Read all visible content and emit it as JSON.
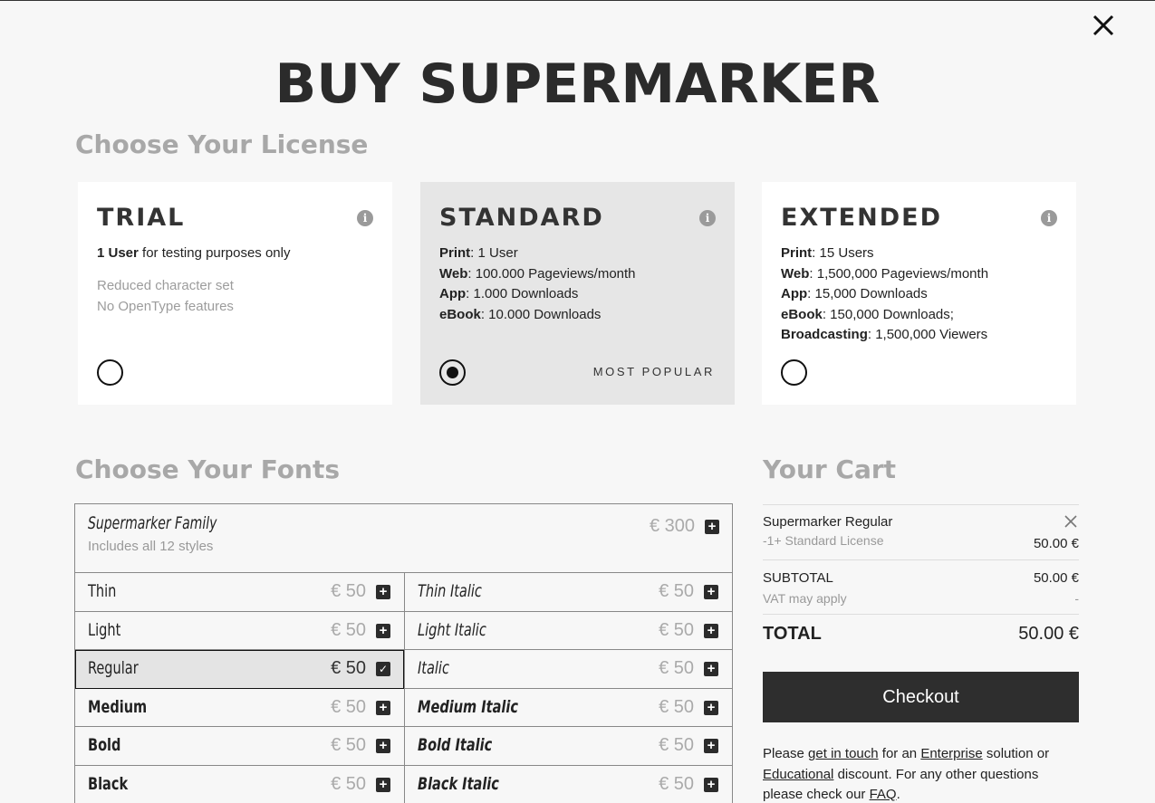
{
  "page": {
    "title": "BUY SUPERMARKER",
    "license_heading": "Choose Your License",
    "fonts_heading": "Choose Your Fonts",
    "cart_heading": "Your Cart"
  },
  "licenses": [
    {
      "name": "TRIAL",
      "selected": false,
      "lines": [
        {
          "bold": "1 User",
          "text": " for testing purposes only"
        }
      ],
      "muted": [
        "Reduced character set",
        "No OpenType features"
      ]
    },
    {
      "name": "STANDARD",
      "selected": true,
      "badge": "MOST POPULAR",
      "lines": [
        {
          "bold": "Print",
          "text": ": 1 User"
        },
        {
          "bold": "Web",
          "text": ": 100.000 Pageviews/month"
        },
        {
          "bold": "App",
          "text": ": 1.000 Downloads"
        },
        {
          "bold": "eBook",
          "text": ": 10.000 Downloads"
        }
      ]
    },
    {
      "name": "EXTENDED",
      "selected": false,
      "lines": [
        {
          "bold": "Print",
          "text": ": 15 Users"
        },
        {
          "bold": "Web",
          "text": ": 1,500,000 Pageviews/month"
        },
        {
          "bold": "App",
          "text": ": 15,000 Downloads"
        },
        {
          "bold": "eBook",
          "text": ": 150,000 Downloads;"
        },
        {
          "bold": "Broadcasting",
          "text": ": 1,500,000 Viewers"
        }
      ]
    }
  ],
  "family": {
    "name": "Supermarker Family",
    "subtitle": "Includes all 12 styles",
    "price": "€ 300"
  },
  "styles": [
    {
      "left": "Thin",
      "left_price": "€ 50",
      "left_weight": 300,
      "right": "Thin Italic",
      "right_price": "€ 50"
    },
    {
      "left": "Light",
      "left_price": "€ 50",
      "left_weight": 400,
      "right": "Light Italic",
      "right_price": "€ 50"
    },
    {
      "left": "Regular",
      "left_price": "€ 50",
      "left_weight": 400,
      "left_selected": true,
      "right": "Italic",
      "right_price": "€ 50"
    },
    {
      "left": "Medium",
      "left_price": "€ 50",
      "left_weight": 700,
      "right": "Medium Italic",
      "right_price": "€ 50"
    },
    {
      "left": "Bold",
      "left_price": "€ 50",
      "left_weight": 700,
      "right": "Bold Italic",
      "right_price": "€ 50"
    },
    {
      "left": "Black",
      "left_price": "€ 50",
      "left_weight": 800,
      "right": "Black Italic",
      "right_price": "€ 50"
    }
  ],
  "cart": {
    "item_name": "Supermarker Regular",
    "item_license": "-1+ Standard License",
    "item_price": "50.00 €",
    "subtotal_label": "SUBTOTAL",
    "subtotal_value": "50.00 €",
    "vat_label": "VAT may apply",
    "vat_value": "-",
    "total_label": "TOTAL",
    "total_value": "50.00 €",
    "checkout_label": "Checkout"
  },
  "help": {
    "t1": "Please ",
    "link1": "get in touch",
    "t2": " for an ",
    "link2": "Enterprise",
    "t3": " solution or ",
    "link3": "Educational",
    "t4": " discount. For any other questions please check our ",
    "link4": "FAQ",
    "t5": "."
  },
  "icons": {
    "close": "close-icon",
    "info": "info-icon",
    "add": "plus-square-icon",
    "checked": "checkbox-checked-icon",
    "remove": "remove-icon"
  }
}
